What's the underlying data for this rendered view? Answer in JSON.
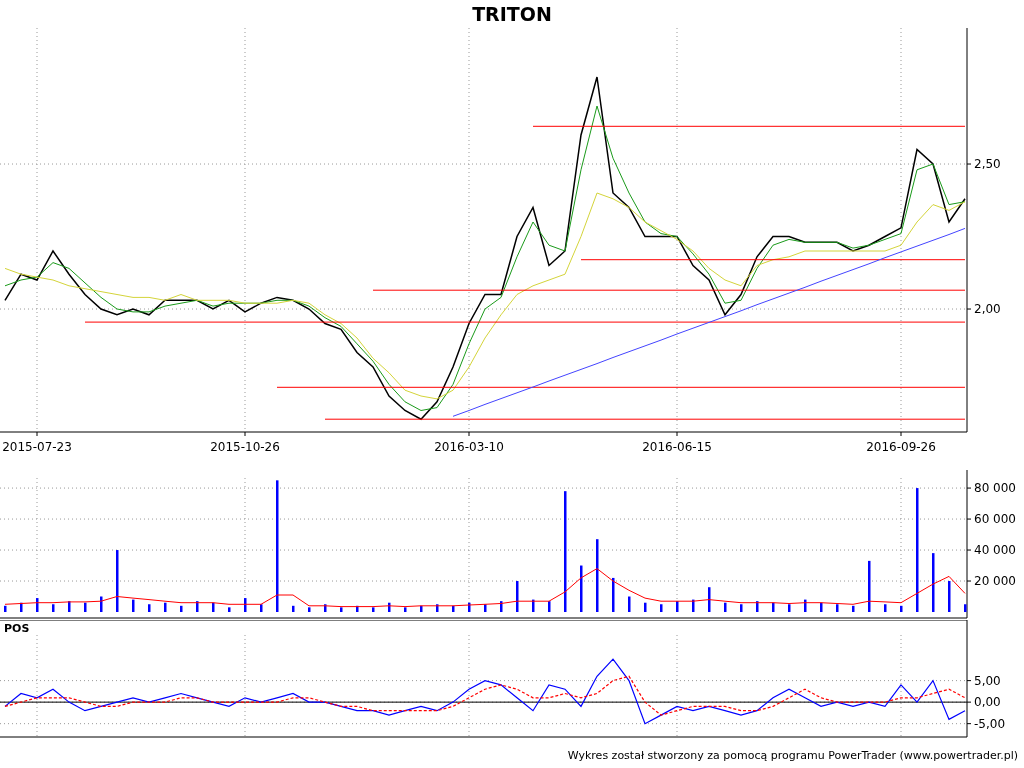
{
  "title": "TRITON",
  "price_chart": {
    "chart_data": {
      "type": "line",
      "grid": true,
      "categories": [
        null,
        null,
        "2015-07-23",
        null,
        null,
        null,
        null,
        null,
        null,
        null,
        null,
        null,
        null,
        null,
        null,
        "2015-10-26",
        null,
        null,
        null,
        null,
        null,
        null,
        null,
        null,
        null,
        null,
        null,
        null,
        null,
        "2016-03-10",
        null,
        null,
        null,
        null,
        null,
        null,
        null,
        null,
        null,
        null,
        null,
        null,
        "2016-06-15",
        null,
        null,
        null,
        null,
        null,
        null,
        null,
        null,
        null,
        null,
        null,
        null,
        null,
        "2016-09-26",
        null,
        null,
        null,
        null
      ],
      "ylim": [
        1.576,
        2.969
      ],
      "yticks": [
        {
          "value": 2.0,
          "label": "2,00"
        },
        {
          "value": 2.5,
          "label": "2,50"
        }
      ],
      "series": [
        {
          "color": "#000000",
          "values": [
            2.03,
            2.12,
            2.1,
            2.2,
            2.12,
            2.05,
            2.0,
            1.98,
            2.0,
            1.98,
            2.03,
            2.03,
            2.03,
            2.0,
            2.03,
            1.99,
            2.02,
            2.04,
            2.03,
            2.0,
            1.95,
            1.93,
            1.85,
            1.8,
            1.7,
            1.65,
            1.62,
            1.68,
            1.8,
            1.95,
            2.05,
            2.05,
            2.25,
            2.35,
            2.15,
            2.2,
            2.6,
            2.8,
            2.4,
            2.35,
            2.25,
            2.25,
            2.25,
            2.15,
            2.1,
            1.98,
            2.05,
            2.18,
            2.25,
            2.25,
            2.23,
            2.23,
            2.23,
            2.2,
            2.22,
            2.25,
            2.28,
            2.55,
            2.5,
            2.3,
            2.38
          ]
        },
        {
          "color": "#1a9a1a",
          "values": [
            2.08,
            2.1,
            2.11,
            2.16,
            2.14,
            2.09,
            2.04,
            2.0,
            1.99,
            1.99,
            2.01,
            2.02,
            2.03,
            2.01,
            2.02,
            2.02,
            2.02,
            2.03,
            2.03,
            2.01,
            1.97,
            1.94,
            1.88,
            1.82,
            1.74,
            1.68,
            1.65,
            1.66,
            1.74,
            1.88,
            2.0,
            2.04,
            2.18,
            2.3,
            2.22,
            2.2,
            2.48,
            2.7,
            2.52,
            2.4,
            2.3,
            2.26,
            2.25,
            2.19,
            2.12,
            2.02,
            2.03,
            2.14,
            2.22,
            2.24,
            2.23,
            2.23,
            2.23,
            2.21,
            2.22,
            2.24,
            2.26,
            2.48,
            2.5,
            2.36,
            2.37
          ]
        },
        {
          "color": "#d4d43a",
          "values": [
            2.14,
            2.12,
            2.11,
            2.1,
            2.08,
            2.07,
            2.06,
            2.05,
            2.04,
            2.04,
            2.03,
            2.05,
            2.03,
            2.03,
            2.03,
            2.02,
            2.02,
            2.02,
            2.03,
            2.02,
            1.98,
            1.95,
            1.9,
            1.83,
            1.78,
            1.72,
            1.7,
            1.69,
            1.72,
            1.8,
            1.9,
            1.98,
            2.05,
            2.08,
            2.1,
            2.12,
            2.25,
            2.4,
            2.38,
            2.35,
            2.3,
            2.27,
            2.24,
            2.2,
            2.14,
            2.1,
            2.08,
            2.15,
            2.17,
            2.18,
            2.2,
            2.2,
            2.2,
            2.2,
            2.2,
            2.2,
            2.22,
            2.3,
            2.36,
            2.34,
            2.37
          ]
        },
        {
          "color": "#ff0000",
          "values": [
            null,
            null,
            null,
            null,
            null,
            null,
            null,
            null,
            null,
            null,
            null,
            null,
            null,
            null,
            null,
            null,
            null,
            null,
            null,
            null,
            null,
            null,
            null,
            null,
            null,
            null,
            null,
            null,
            null,
            null,
            null,
            null,
            null,
            2.63,
            2.63,
            2.63,
            2.63,
            2.63,
            2.63,
            2.63,
            2.63,
            2.63,
            2.63,
            2.63,
            2.63,
            2.63,
            2.63,
            2.63,
            2.63,
            2.63,
            2.63,
            2.63,
            2.63,
            2.63,
            2.63,
            2.63,
            2.63,
            2.63,
            2.63,
            2.63,
            2.63
          ]
        },
        {
          "color": "#ff0000",
          "values": [
            null,
            null,
            null,
            null,
            null,
            null,
            null,
            null,
            null,
            null,
            null,
            null,
            null,
            null,
            null,
            null,
            null,
            null,
            null,
            null,
            null,
            null,
            null,
            null,
            null,
            null,
            null,
            null,
            null,
            null,
            null,
            null,
            null,
            null,
            null,
            null,
            2.17,
            2.17,
            2.17,
            2.17,
            2.17,
            2.17,
            2.17,
            2.17,
            2.17,
            2.17,
            2.17,
            2.17,
            2.17,
            2.17,
            2.17,
            2.17,
            2.17,
            2.17,
            2.17,
            2.17,
            2.17,
            2.17,
            2.17,
            2.17,
            2.17
          ]
        },
        {
          "color": "#ff0000",
          "values": [
            null,
            null,
            null,
            null,
            null,
            null,
            null,
            null,
            null,
            null,
            null,
            null,
            null,
            null,
            null,
            null,
            null,
            null,
            null,
            null,
            null,
            null,
            null,
            2.065,
            2.065,
            2.065,
            2.065,
            2.065,
            2.065,
            2.065,
            2.065,
            2.065,
            2.065,
            2.065,
            2.065,
            2.065,
            2.065,
            2.065,
            2.065,
            2.065,
            2.065,
            2.065,
            2.065,
            2.065,
            2.065,
            2.065,
            2.065,
            2.065,
            2.065,
            2.065,
            2.065,
            2.065,
            2.065,
            2.065,
            2.065,
            2.065,
            2.065,
            2.065,
            2.065,
            2.065,
            2.065
          ]
        },
        {
          "color": "#ff0000",
          "values": [
            null,
            null,
            null,
            null,
            null,
            1.955,
            1.955,
            1.955,
            1.955,
            1.955,
            1.955,
            1.955,
            1.955,
            1.955,
            1.955,
            1.955,
            1.955,
            1.955,
            1.955,
            1.955,
            1.955,
            1.955,
            1.955,
            1.955,
            1.955,
            1.955,
            1.955,
            1.955,
            1.955,
            1.955,
            1.955,
            1.955,
            1.955,
            1.955,
            1.955,
            1.955,
            1.955,
            1.955,
            1.955,
            1.955,
            1.955,
            1.955,
            1.955,
            1.955,
            1.955,
            1.955,
            1.955,
            1.955,
            1.955,
            1.955,
            1.955,
            1.955,
            1.955,
            1.955,
            1.955,
            1.955,
            1.955,
            1.955,
            1.955,
            1.955,
            1.955
          ]
        },
        {
          "color": "#ff0000",
          "values": [
            null,
            null,
            null,
            null,
            null,
            null,
            null,
            null,
            null,
            null,
            null,
            null,
            null,
            null,
            null,
            null,
            null,
            1.73,
            1.73,
            1.73,
            1.73,
            1.73,
            1.73,
            1.73,
            1.73,
            1.73,
            1.73,
            1.73,
            1.73,
            1.73,
            1.73,
            1.73,
            1.73,
            1.73,
            1.73,
            1.73,
            1.73,
            1.73,
            1.73,
            1.73,
            1.73,
            1.73,
            1.73,
            1.73,
            1.73,
            1.73,
            1.73,
            1.73,
            1.73,
            1.73,
            1.73,
            1.73,
            1.73,
            1.73,
            1.73,
            1.73,
            1.73,
            1.73,
            1.73,
            1.73,
            1.73
          ]
        },
        {
          "color": "#ff0000",
          "values": [
            null,
            null,
            null,
            null,
            null,
            null,
            null,
            null,
            null,
            null,
            null,
            null,
            null,
            null,
            null,
            null,
            null,
            null,
            null,
            null,
            1.62,
            1.62,
            1.62,
            1.62,
            1.62,
            1.62,
            1.62,
            1.62,
            1.62,
            1.62,
            1.62,
            1.62,
            1.62,
            1.62,
            1.62,
            1.62,
            1.62,
            1.62,
            1.62,
            1.62,
            1.62,
            1.62,
            1.62,
            1.62,
            1.62,
            1.62,
            1.62,
            1.62,
            1.62,
            1.62,
            1.62,
            1.62,
            1.62,
            1.62,
            1.62,
            1.62,
            1.62,
            1.62,
            1.62,
            1.62,
            1.62
          ]
        },
        {
          "color": "#4444ff",
          "values": [
            null,
            null,
            null,
            null,
            null,
            null,
            null,
            null,
            null,
            null,
            null,
            null,
            null,
            null,
            null,
            null,
            null,
            null,
            null,
            null,
            null,
            null,
            null,
            null,
            null,
            null,
            null,
            null,
            1.63,
            1.65,
            1.671,
            1.691,
            1.711,
            1.731,
            1.752,
            1.772,
            1.792,
            1.812,
            1.833,
            1.853,
            1.873,
            1.893,
            1.914,
            1.934,
            1.954,
            1.974,
            1.994,
            2.015,
            2.035,
            2.055,
            2.075,
            2.096,
            2.116,
            2.136,
            2.156,
            2.177,
            2.197,
            2.217,
            2.237,
            2.257,
            2.278
          ]
        }
      ]
    }
  },
  "volume_chart": {
    "chart_data": {
      "type": "bar",
      "grid": true,
      "categories": [
        null,
        null,
        null,
        null,
        null,
        null,
        null,
        null,
        null,
        null,
        null,
        null,
        null,
        null,
        null,
        null,
        null,
        null,
        null,
        null,
        null,
        null,
        null,
        null,
        null,
        null,
        null,
        null,
        null,
        null,
        null,
        null,
        null,
        null,
        null,
        null,
        null,
        null,
        null,
        null,
        null,
        null,
        null,
        null,
        null,
        null,
        null,
        null,
        null,
        null,
        null,
        null,
        null,
        null,
        null,
        null,
        null,
        null,
        null,
        null,
        null
      ],
      "ylim": [
        0,
        86500
      ],
      "yticks": [
        {
          "value": 20000,
          "label": "20 000"
        },
        {
          "value": 40000,
          "label": "40 000"
        },
        {
          "value": 60000,
          "label": "60 000"
        },
        {
          "value": 80000,
          "label": "80 000"
        }
      ],
      "series": [
        {
          "color": "#0000ff",
          "values": [
            4000,
            6000,
            9000,
            5000,
            7000,
            6000,
            10000,
            40000,
            8000,
            5000,
            6000,
            4000,
            7000,
            6000,
            3000,
            9000,
            5000,
            85000,
            4000,
            3000,
            5000,
            3000,
            4000,
            3000,
            6000,
            3000,
            4000,
            5000,
            4000,
            6000,
            5000,
            7000,
            20000,
            8000,
            7000,
            78000,
            30000,
            47000,
            22000,
            10000,
            6000,
            5000,
            7000,
            8000,
            16000,
            6000,
            5000,
            7000,
            6000,
            5000,
            8000,
            6000,
            5000,
            4000,
            33000,
            5000,
            4000,
            80000,
            38000,
            20000,
            5000
          ]
        },
        {
          "type": "line",
          "color": "#ff0000",
          "values": [
            5000,
            5500,
            6000,
            6000,
            6500,
            6500,
            7000,
            10000,
            9000,
            8000,
            7000,
            6000,
            6000,
            6000,
            5000,
            5000,
            5000,
            11000,
            11000,
            4000,
            4000,
            3500,
            3500,
            3500,
            4000,
            3500,
            4000,
            4000,
            4000,
            4500,
            5000,
            5500,
            7000,
            7000,
            7000,
            13000,
            22000,
            28000,
            20000,
            14000,
            9000,
            7000,
            7000,
            7000,
            8000,
            7000,
            6000,
            6000,
            6000,
            5500,
            6000,
            6000,
            5500,
            5000,
            7000,
            6500,
            6000,
            12000,
            18000,
            23000,
            12000
          ]
        }
      ]
    }
  },
  "pos_chart": {
    "title": "POS",
    "chart_data": {
      "type": "line",
      "grid": true,
      "categories": [
        null,
        null,
        null,
        null,
        null,
        null,
        null,
        null,
        null,
        null,
        null,
        null,
        null,
        null,
        null,
        null,
        null,
        null,
        null,
        null,
        null,
        null,
        null,
        null,
        null,
        null,
        null,
        null,
        null,
        null,
        null,
        null,
        null,
        null,
        null,
        null,
        null,
        null,
        null,
        null,
        null,
        null,
        null,
        null,
        null,
        null,
        null,
        null,
        null,
        null,
        null,
        null,
        null,
        null,
        null,
        null,
        null,
        null,
        null,
        null,
        null
      ],
      "ylim": [
        -8.1,
        15.6
      ],
      "yticks": [
        {
          "value": 5,
          "label": "5,00"
        },
        {
          "value": 0,
          "label": "0,00"
        },
        {
          "value": -5,
          "label": "-5,00"
        }
      ],
      "series": [
        {
          "color": "#0000ff",
          "values": [
            -1,
            2,
            1,
            3,
            0,
            -2,
            -1,
            0,
            1,
            0,
            1,
            2,
            1,
            0,
            -1,
            1,
            0,
            1,
            2,
            0,
            0,
            -1,
            -2,
            -2,
            -3,
            -2,
            -1,
            -2,
            0,
            3,
            5,
            4,
            1,
            -2,
            4,
            3,
            -1,
            6,
            10,
            5,
            -5,
            -3,
            -1,
            -2,
            -1,
            -2,
            -3,
            -2,
            1,
            3,
            1,
            -1,
            0,
            -1,
            0,
            -1,
            4,
            0,
            5,
            -4,
            -2
          ]
        },
        {
          "color": "#ff0000",
          "line_style": "dashed",
          "values": [
            -1,
            0,
            1,
            1,
            1,
            0,
            -1,
            -1,
            0,
            0,
            0,
            1,
            1,
            0,
            0,
            0,
            0,
            0,
            1,
            1,
            0,
            -1,
            -1,
            -2,
            -2,
            -2,
            -2,
            -2,
            -1,
            1,
            3,
            4,
            3,
            1,
            1,
            2,
            1,
            2,
            5,
            6,
            0,
            -3,
            -2,
            -1,
            -1,
            -1,
            -2,
            -2,
            -1,
            1,
            3,
            1,
            0,
            0,
            0,
            0,
            1,
            1,
            2,
            3,
            1
          ]
        }
      ]
    }
  },
  "footer": "Wykres został stworzony za pomocą programu PowerTrader (www.powertrader.pl)"
}
